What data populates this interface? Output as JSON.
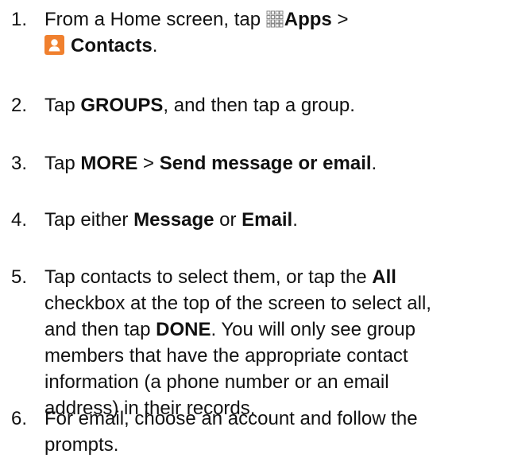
{
  "steps": [
    {
      "number": "1.",
      "text_1": "From a Home screen, tap",
      "apps_label": "Apps",
      "separator": ">",
      "contacts_label": "Contacts",
      "end": "."
    },
    {
      "number": "2.",
      "text_1": "Tap",
      "bold_1": "GROUPS",
      "text_2": ", and then tap a group."
    },
    {
      "number": "3.",
      "text_1": "Tap",
      "bold_1": "MORE",
      "separator": ">",
      "bold_2": "Send message or email",
      "end": "."
    },
    {
      "number": "4.",
      "text_1": "Tap either",
      "bold_1": "Message",
      "text_2": "or",
      "bold_2": "Email",
      "end": "."
    },
    {
      "number": "5.",
      "line_1a": "Tap contacts to select them, or tap the",
      "line_1b": "All",
      "line_2": "checkbox at the top of the screen to select all,",
      "line_3a": "and then tap",
      "line_3b": "DONE",
      "line_3c": ". You will only see group",
      "line_4": "members that have the appropriate contact",
      "line_5": "information (a phone number or an email",
      "line_6": "address) in their records."
    },
    {
      "number": "6.",
      "line_1": "For email, choose an account and follow the",
      "line_2": "prompts."
    }
  ],
  "icons": {
    "apps_icon": "apps-grid-icon",
    "contacts_icon": "contacts-person-icon",
    "contacts_color": "#f0802e"
  }
}
